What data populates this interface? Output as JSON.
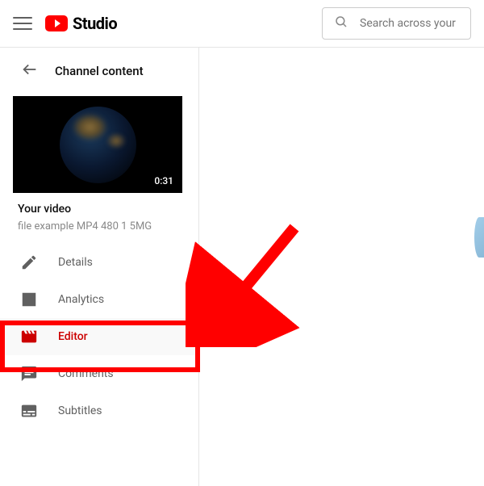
{
  "header": {
    "logo_text": "Studio",
    "search": {
      "placeholder": "Search across your channel"
    }
  },
  "sidebar": {
    "back_label": "Channel content",
    "video": {
      "duration": "0:31",
      "title_label": "Your video",
      "filename": "file example MP4 480 1 5MG"
    },
    "nav": [
      {
        "id": "details",
        "label": "Details",
        "icon": "pencil-icon",
        "active": false
      },
      {
        "id": "analytics",
        "label": "Analytics",
        "icon": "analytics-icon",
        "active": false
      },
      {
        "id": "editor",
        "label": "Editor",
        "icon": "clapper-icon",
        "active": true
      },
      {
        "id": "comments",
        "label": "Comments",
        "icon": "comments-icon",
        "active": false
      },
      {
        "id": "subtitles",
        "label": "Subtitles",
        "icon": "subtitles-icon",
        "active": false
      }
    ]
  },
  "annotation": {
    "highlight_target": "editor",
    "arrow_color": "#ff0000"
  }
}
